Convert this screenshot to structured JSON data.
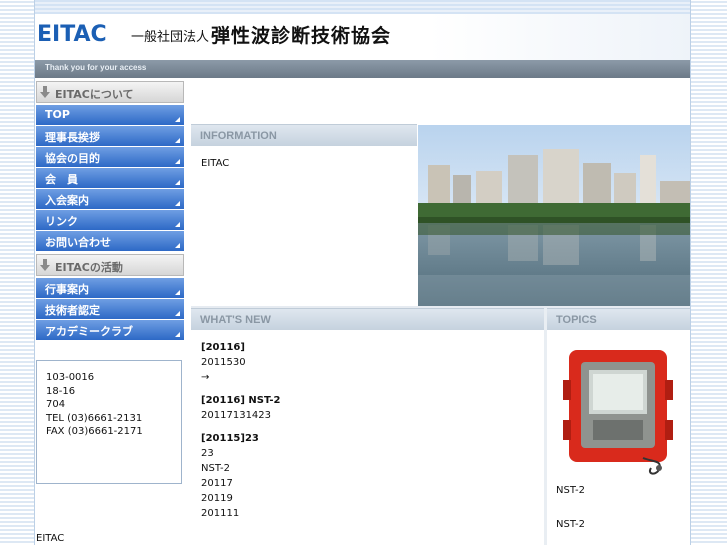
{
  "header": {
    "logo_text": "EITAC",
    "logo_prefix": "",
    "logo_suffix": "",
    "org_prefix": "一般社団法人",
    "org_name": "弾性波診断技術協会",
    "tagline": "Thank you for your access"
  },
  "sidebar": {
    "section1_title": "EITACについて",
    "section1_items": [
      {
        "label": "TOP"
      },
      {
        "label": "理事長挨拶"
      },
      {
        "label": "協会の目的"
      },
      {
        "label": "会　員"
      },
      {
        "label": "入会案内"
      },
      {
        "label": "リンク"
      },
      {
        "label": "お問い合わせ"
      }
    ],
    "section2_title": "EITACの活動",
    "section2_items": [
      {
        "label": "行事案内"
      },
      {
        "label": "技術者認定"
      },
      {
        "label": "アカデミークラブ"
      }
    ],
    "address": {
      "line1": "",
      "line2": "",
      "postal": "103-0016",
      "line4": "",
      "line5": "18-16",
      "line6": "704",
      "tel": "TEL (03)6661-2131",
      "fax": "FAX (03)6661-2171"
    },
    "link_text": "",
    "bottom_text": "EITAC"
  },
  "main": {
    "intro": "",
    "info_title": "INFORMATION",
    "info_text_a": "EITAC",
    "info_text_b": "",
    "whats_new_title": "WHAT'S NEW",
    "topics_title": "TOPICS",
    "news": [
      {
        "head_a": "[2011",
        "head_b": "6",
        "head_c": "]",
        "line1": "2011",
        "line1b": "5",
        "line1c": "30",
        "line2_link": "",
        "arrow": "→"
      },
      {
        "head_a": "[2011",
        "head_b": "6",
        "head_c": "] NST-2",
        "line1": "2011",
        "line1b": "7",
        "line1c": "13",
        "line1d": "14",
        "line1e": "23",
        "link": ""
      },
      {
        "head_a": "[2011",
        "head_b": "5",
        "head_c": "]",
        "head_d": "23",
        "line1": "23",
        "line2": "NST-2",
        "line3": "2011",
        "line3b": "7",
        "line4": "2011",
        "line4b": "9",
        "line5": "2011",
        "line5b": "11"
      }
    ],
    "topics_text_a": "NST-2",
    "topics_text_b": "NST-2"
  },
  "colors": {
    "nav_blue": "#2d69c6",
    "link_blue": "#1b63c6",
    "logo_blue": "#1b5fb4",
    "band_gray": "#c5d2de"
  }
}
